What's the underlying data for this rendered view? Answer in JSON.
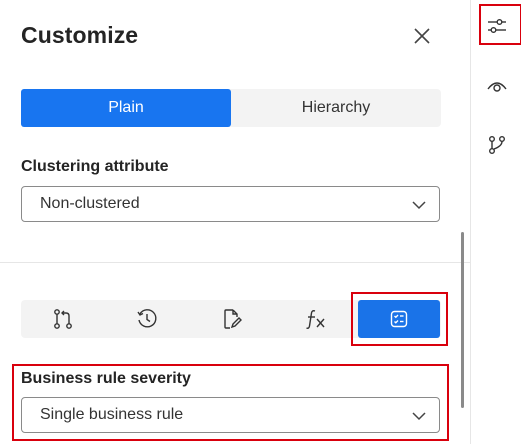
{
  "panel": {
    "title": "Customize",
    "layout_tabs": [
      {
        "label": "Plain",
        "active": true
      },
      {
        "label": "Hierarchy",
        "active": false
      }
    ],
    "clustering": {
      "label": "Clustering attribute",
      "value": "Non-clustered"
    },
    "view_icons": [
      {
        "icon": "diff-compare-icon",
        "active": false
      },
      {
        "icon": "history-clock-icon",
        "active": false
      },
      {
        "icon": "edit-document-icon",
        "active": false
      },
      {
        "icon": "function-fx-icon",
        "active": false
      },
      {
        "icon": "business-rule-checklist-icon",
        "active": true
      }
    ],
    "severity": {
      "label": "Business rule severity",
      "value": "Single business rule"
    }
  },
  "rail": {
    "items": [
      {
        "icon": "sliders-settings-icon",
        "highlighted": true
      },
      {
        "icon": "eye-visibility-icon",
        "highlighted": false
      },
      {
        "icon": "branch-merge-icon",
        "highlighted": false
      }
    ]
  },
  "colors": {
    "accent": "#1a73e8",
    "highlight_box": "#d9000d",
    "segment_bg": "#f3f3f3"
  }
}
